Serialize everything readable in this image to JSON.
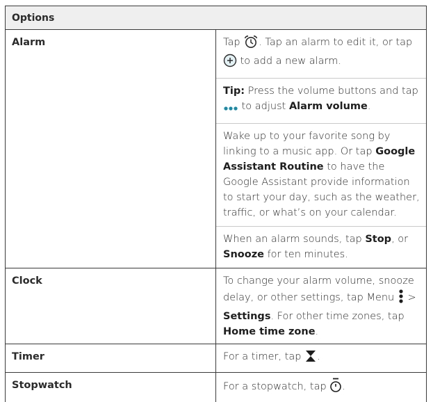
{
  "header": {
    "title": "Options"
  },
  "rows": {
    "alarm": {
      "label": "Alarm",
      "p1": {
        "a": "Tap ",
        "b": ". Tap an alarm to edit it, or tap ",
        "c": " to add a new alarm."
      },
      "p2": {
        "tip": "Tip:",
        "a": " Press the volume buttons and tap ",
        "b": " to adjust ",
        "bold": "Alarm volume",
        "c": "."
      },
      "p3": {
        "a": "Wake up to your favorite song by linking to a music app. Or tap ",
        "bold": "Google Assistant Routine",
        "b": " to have the Google Assistant provide information to start your day, such as the weather, traffic, or what’s on your calendar."
      },
      "p4": {
        "a": "When an alarm sounds, tap ",
        "stop": "Stop",
        "b": ", or ",
        "snooze": "Snooze",
        "c": " for ten minutes."
      }
    },
    "clock": {
      "label": "Clock",
      "a": "To change your alarm volume, snooze delay, or other settings, tap Menu ",
      "b": " > ",
      "settings": "Settings",
      "c": ". For other time zones, tap ",
      "home": "Home time zone",
      "d": "."
    },
    "timer": {
      "label": "Timer",
      "a": "For a timer, tap ",
      "b": "."
    },
    "stopwatch": {
      "label": "Stopwatch",
      "a": "For a stopwatch, tap ",
      "b": "."
    }
  },
  "icons": {
    "alarm": "alarm-clock-icon",
    "add": "plus-circle-icon",
    "more": "more-dots-icon",
    "menu": "menu-vertical-dots-icon",
    "timer": "hourglass-icon",
    "stopwatch": "stopwatch-icon"
  },
  "colors": {
    "accent": "#1a8aa6",
    "border": "#3a3a3a",
    "header_bg": "#efefef"
  }
}
